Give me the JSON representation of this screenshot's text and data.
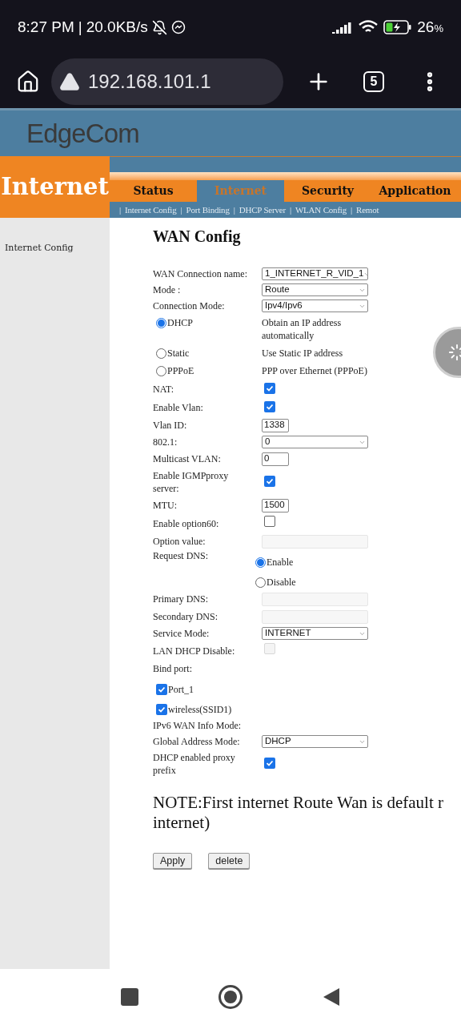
{
  "status_bar": {
    "time": "8:27 PM",
    "separator": "|",
    "speed": "20.0KB/s",
    "battery": "26",
    "battery_unit": "%"
  },
  "browser": {
    "url": "192.168.101.1",
    "tab_count": "5"
  },
  "header": {
    "logo": "EdgeCom",
    "section_title": "Internet"
  },
  "tabs": [
    {
      "label": "Status",
      "selected": false
    },
    {
      "label": "Internet",
      "selected": true
    },
    {
      "label": "Security",
      "selected": false
    },
    {
      "label": "Application",
      "selected": false
    }
  ],
  "submenu": [
    {
      "label": "Internet Config"
    },
    {
      "label": "Port Binding"
    },
    {
      "label": "DHCP Server"
    },
    {
      "label": "WLAN Config"
    },
    {
      "label": "Remot"
    }
  ],
  "submenu_separator": "|",
  "sidebar": {
    "items": [
      {
        "label": "Internet Config"
      }
    ]
  },
  "form": {
    "title": "WAN Config",
    "rows": [
      {
        "kind": "select",
        "label": "WAN Connection name:",
        "value": "1_INTERNET_R_VID_1"
      },
      {
        "kind": "select",
        "label": "Mode :",
        "value": "Route"
      },
      {
        "kind": "select",
        "label": "Connection Mode:",
        "value": "Ipv4/Ipv6"
      },
      {
        "kind": "radio_option",
        "option": "DHCP",
        "description": "Obtain an IP address automatically",
        "selected": true
      },
      {
        "kind": "radio_option",
        "option": "Static",
        "description": "Use Static IP address",
        "selected": false
      },
      {
        "kind": "radio_option",
        "option": "PPPoE",
        "description": "PPP over Ethernet (PPPoE)",
        "selected": false
      },
      {
        "kind": "checkbox",
        "label": "NAT:",
        "checked": true
      },
      {
        "kind": "checkbox",
        "label": "Enable Vlan:",
        "checked": true
      },
      {
        "kind": "short_input",
        "label": "Vlan ID:",
        "value": "1338"
      },
      {
        "kind": "select",
        "label": "802.1:",
        "value": "0"
      },
      {
        "kind": "short_input",
        "label": "Multicast VLAN:",
        "value": "0"
      },
      {
        "kind": "checkbox",
        "label": "Enable IGMPproxy server:",
        "checked": true
      },
      {
        "kind": "short_input",
        "label": "MTU:",
        "value": "1500"
      },
      {
        "kind": "checkbox",
        "label": "Enable option60:",
        "checked": false
      },
      {
        "kind": "input",
        "label": "Option value:",
        "disabled": true
      },
      {
        "kind": "radio_group",
        "label": "Request DNS:",
        "options": [
          {
            "label": "Enable",
            "selected": true
          },
          {
            "label": "Disable",
            "selected": false
          }
        ]
      },
      {
        "kind": "input",
        "label": "Primary DNS:",
        "disabled": true
      },
      {
        "kind": "input",
        "label": "Secondary DNS:",
        "disabled": true
      },
      {
        "kind": "select",
        "label": "Service Mode:",
        "value": "INTERNET"
      },
      {
        "kind": "checkbox",
        "label": "LAN DHCP Disable:",
        "checked": false,
        "disabled": true
      },
      {
        "kind": "heading",
        "label": "Bind port:"
      },
      {
        "kind": "check_option",
        "label": "Port_1",
        "checked": true
      },
      {
        "kind": "check_option",
        "label": "wireless(SSID1)",
        "checked": true
      },
      {
        "kind": "heading",
        "label": "IPv6 WAN Info Mode:"
      },
      {
        "kind": "select",
        "label": "Global Address Mode:",
        "value": "DHCP"
      },
      {
        "kind": "checkbox",
        "label": "DHCP enabled proxy prefix",
        "checked": true
      }
    ],
    "note_lines": [
      "NOTE:First internet Route Wan is default r",
      "internet)"
    ],
    "buttons": [
      "Apply",
      "delete"
    ]
  }
}
